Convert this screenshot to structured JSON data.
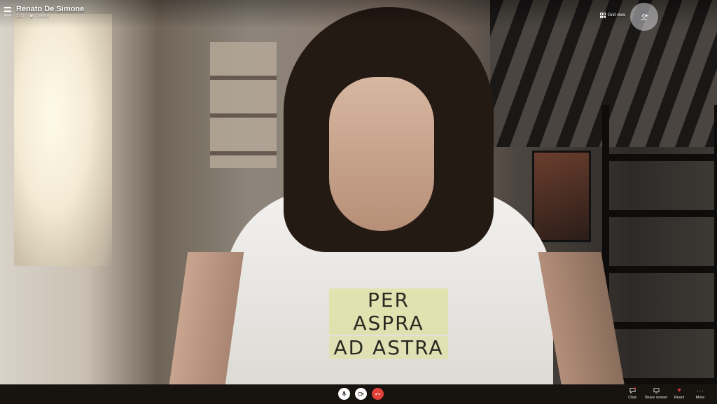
{
  "call": {
    "participant_name": "Renato De Simone",
    "duration": "3:03",
    "layout_label": "Gallery"
  },
  "top_controls": {
    "grid_view_label": "Grid view",
    "add_people_icon": "add-people-icon"
  },
  "video": {
    "shirt_text_line1": "PER ASPRA",
    "shirt_text_line2": "AD ASTRA"
  },
  "bottom_controls": {
    "mic_icon": "microphone-icon",
    "video_icon": "video-camera-icon",
    "end_call_icon": "end-call-icon",
    "end_call_color": "#e2413a",
    "actions": [
      {
        "label": "Chat",
        "icon": "chat-icon"
      },
      {
        "label": "Share screen",
        "icon": "share-screen-icon"
      },
      {
        "label": "React",
        "icon": "heart-icon"
      },
      {
        "label": "More",
        "icon": "more-icon"
      }
    ]
  }
}
